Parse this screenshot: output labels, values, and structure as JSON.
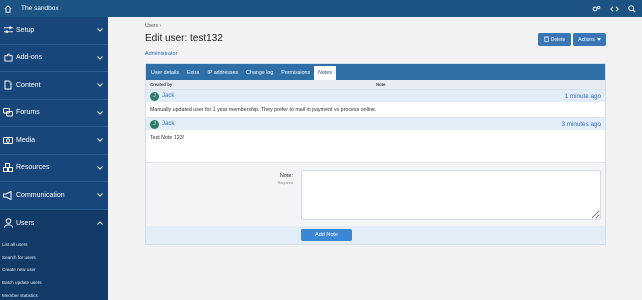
{
  "topbar": {
    "site_name": "The sandbox"
  },
  "sidebar": {
    "items": [
      {
        "label": "Setup"
      },
      {
        "label": "Add-ons"
      },
      {
        "label": "Content"
      },
      {
        "label": "Forums"
      },
      {
        "label": "Media"
      },
      {
        "label": "Resources"
      },
      {
        "label": "Communication"
      },
      {
        "label": "Users"
      }
    ],
    "subitems": [
      "List all users",
      "Search for users",
      "Create new user",
      "Batch update users",
      "Member statistics"
    ]
  },
  "main": {
    "breadcrumb": "Users",
    "title": "Edit user: test132",
    "role": "Administrator",
    "delete_label": "Delete",
    "actions_label": "Actions"
  },
  "tabs": [
    "User details",
    "Extra",
    "IP addresses",
    "Change log",
    "Permissions",
    "Notes"
  ],
  "active_tab": "Notes",
  "columns": {
    "created_by": "Created by",
    "note": "Note"
  },
  "notes": [
    {
      "author": "Jack",
      "avatar_letter": "J",
      "time": "1 minute ago",
      "text": "Manually updated user for 1 year membership. They prefer to mail in payment vs process online."
    },
    {
      "author": "Jack",
      "avatar_letter": "J",
      "time": "3 minutes ago",
      "text": "Test Note 123!"
    }
  ],
  "form": {
    "label": "Note:",
    "hint": "Required",
    "submit_label": "Add Note"
  },
  "colors": {
    "topbar": "#1d5383",
    "sidebar": "#19467a",
    "accent": "#3a76b6"
  }
}
